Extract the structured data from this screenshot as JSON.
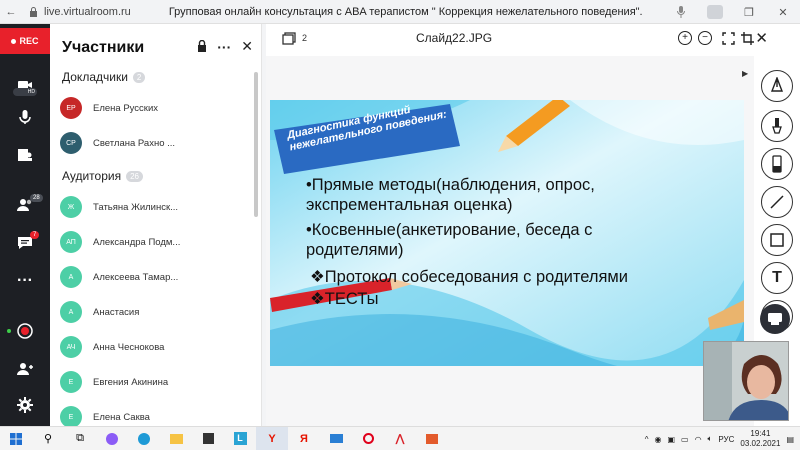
{
  "browser": {
    "url": "live.virtualroom.ru",
    "title": "Групповая онлайн консультация с ABA терапистом \" Коррекция нежелательного поведения\"."
  },
  "rail": {
    "rec_label": "REC",
    "hd_label": "HD",
    "participants_badge": "28",
    "chat_badge": "7"
  },
  "panel": {
    "title": "Участники",
    "speakers_label": "Докладчики",
    "speakers_count": "2",
    "audience_label": "Аудитория",
    "audience_count": "26",
    "speakers": [
      {
        "initials": "ЕР",
        "name": "Елена Русских",
        "color": "#c62828"
      },
      {
        "initials": "СР",
        "name": "Светлана Рахно ...",
        "color": "#2e5e6e"
      }
    ],
    "audience": [
      {
        "initials": "Ж",
        "name": "Татьяна Жилинск...",
        "color": "#4dcfa6"
      },
      {
        "initials": "АП",
        "name": "Александра Подм...",
        "color": "#4dcfa6"
      },
      {
        "initials": "А",
        "name": "Алексеева Тамар...",
        "color": "#4dcfa6"
      },
      {
        "initials": "А",
        "name": "Анастасия",
        "color": "#4dcfa6"
      },
      {
        "initials": "АЧ",
        "name": "Анна Чеснокова",
        "color": "#4dcfa6"
      },
      {
        "initials": "Е",
        "name": "Евгения Акинина",
        "color": "#4dcfa6"
      },
      {
        "initials": "Е",
        "name": "Елена Саква",
        "color": "#4dcfa6"
      }
    ]
  },
  "slide_header": {
    "count": "2",
    "filename": "Слайд22.JPG"
  },
  "slide": {
    "heading": "Диагностика функций нежелательного поведения:",
    "bullets": [
      "•Прямые методы(наблюдения, опрос,",
      " экспрементальная оценка)",
      "•Косвенные(анкетирование, беседа с",
      " родителями)",
      "❖Протокол собеседования с родителями",
      "❖ТЕСТы"
    ]
  },
  "taskbar": {
    "language": "РУС",
    "time": "19:41",
    "date": "03.02.2021"
  },
  "colors": {
    "rec": "#e8212b",
    "rail": "#1d1f24",
    "audience_avatar": "#4dcfa6"
  }
}
